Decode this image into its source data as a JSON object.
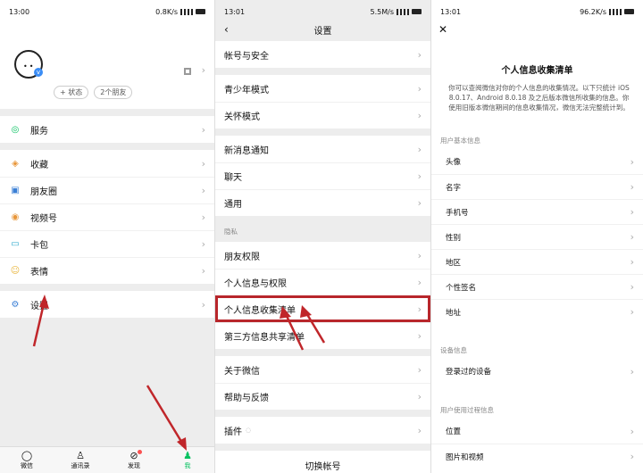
{
  "p1": {
    "time": "13:00",
    "speed": "0.8K/s",
    "tags": [
      "+ 状态",
      "2个朋友"
    ],
    "items": [
      "服务",
      "收藏",
      "朋友圈",
      "视频号",
      "卡包",
      "表情",
      "设置"
    ],
    "tabs": [
      "微信",
      "通讯录",
      "发现",
      "我"
    ]
  },
  "p2": {
    "time": "13:01",
    "speed": "5.5M/s",
    "title": "设置",
    "items": [
      "帐号与安全",
      "青少年模式",
      "关怀模式",
      "新消息通知",
      "聊天",
      "通用"
    ],
    "privacy": "隐私",
    "privacy_items": [
      "朋友权限",
      "个人信息与权限",
      "个人信息收集清单",
      "第三方信息共享清单"
    ],
    "more_items": [
      "关于微信",
      "帮助与反馈"
    ],
    "plugin": "插件",
    "switch": "切换帐号"
  },
  "p3": {
    "time": "13:01",
    "speed": "96.2K/s",
    "title": "个人信息收集清单",
    "desc": "你可以查阅微信对你的个人信息的收集情况。以下只统计 iOS 8.0.17、Android 8.0.18 及之后版本微信所收集的信息。你使用旧版本微信期间的信息收集情况，微信无法完整统计到。",
    "sec1": "用户基本信息",
    "basic": [
      "头像",
      "名字",
      "手机号",
      "性别",
      "地区",
      "个性签名",
      "地址"
    ],
    "sec2": "设备信息",
    "device": [
      "登录过的设备"
    ],
    "sec3": "用户使用过程信息",
    "usage": [
      "位置",
      "图片和视频"
    ]
  }
}
